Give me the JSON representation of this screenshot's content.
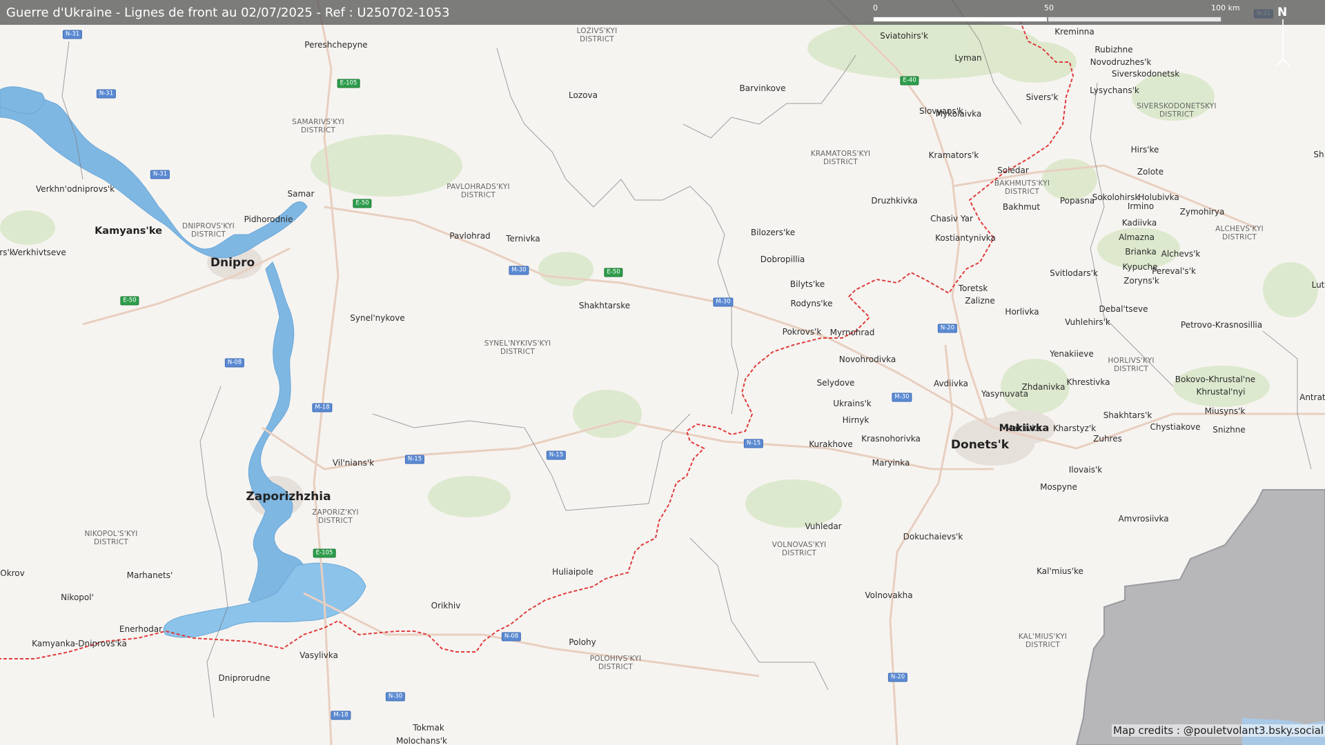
{
  "title": "Guerre d'Ukraine - Lignes de front au 02/07/2025 - Ref : U250702-1053",
  "scale": {
    "labels": [
      "0",
      "50",
      "100 km"
    ]
  },
  "north_label": "N",
  "credits": "Map credits : @pouletvolant3.bsky.social",
  "colors": {
    "frontline": "#e03a3a",
    "water": "#7fb7e3",
    "occupied": "#b7b7ba",
    "land": "#f6f4f1",
    "shield_e": "#2e9d4c",
    "shield_m": "#5b8ad2"
  },
  "cities": [
    "Pereshchepyne",
    "Lozova",
    "Barvinkove",
    "Sviatohirs'k",
    "Lyman",
    "Kreminna",
    "Rubizhne",
    "Novodruzhes'k",
    "Siverskodonetsk",
    "Lysychans'k",
    "Sivers'k",
    "Mykolaivka",
    "Slovyans'k",
    "Kramators'k",
    "Soledar",
    "Hirs'ke",
    "Zolote",
    "Druzhkivka",
    "Bakhmut",
    "Popasna",
    "Sokolohirsk",
    "Holubivka",
    "Irmino",
    "Zymohirya",
    "Chasiv Yar",
    "Kadiivka",
    "Kostiantynivka",
    "Almazna",
    "Bilozers'ke",
    "Brianka",
    "Alchevs'k",
    "Dobropillia",
    "Kypuche",
    "Pereval's'k",
    "Zoryns'k",
    "Bilyts'ke",
    "Toretsk",
    "Svitlodars'k",
    "Zalizne",
    "Rodyns'ke",
    "Horlivka",
    "Debal'tseve",
    "Vuhlehirs'k",
    "Petrovo-Krasnosillia",
    "Pokrovs'k",
    "Myrnohrad",
    "Novohrodivka",
    "Yenakiieve",
    "Selydove",
    "Avdiivka",
    "Zhdanivka",
    "Khrestivka",
    "Bokovo-Khrustal'ne",
    "Khrustal'nyi",
    "Yasynuvata",
    "Ukrains'k",
    "Hirnyk",
    "Makiivka",
    "Shakhtars'k",
    "Miusyns'k",
    "Kharstyz'k",
    "Chystiakove",
    "Snizhne",
    "Zuhres",
    "Krasnohorivka",
    "Kurakhove",
    "Maryinka",
    "Ilovais'k",
    "Mospyne",
    "Vuhledar",
    "Amvrosiivka",
    "Dokuchaievs'k",
    "Kal'mius'ke",
    "Volnovakha",
    "Verkhn'odniprovs'k",
    "Samar",
    "Pidhorodnie",
    "Pavlohrad",
    "Ternivka",
    "Verkhivtseve",
    "Shakhtarske",
    "Synel'nykove",
    "Vil'nians'k",
    "Huliaipole",
    "Marhanets'",
    "Enerhodar",
    "Kamyanka-Dniprovs'ka",
    "Orikhiv",
    "Vasylivka",
    "Dniprorudne",
    "Polohy",
    "Tokmak",
    "Molochans'k",
    "Okrov",
    "rs'k",
    "Nikopol'",
    "Sh",
    "Lut",
    "Antrats"
  ],
  "big_cities": [
    "Dnipro",
    "Zaporizhzhia",
    "Donets'k"
  ],
  "medium_cities": [
    "Kamyans'ke",
    "Makiivka"
  ],
  "districts": [
    "LOZIVS'KYI\nDISTRICT",
    "SAMARIVS'KYI\nDISTRICT",
    "PAVLOHRADS'KYI\nDISTRICT",
    "DNIPROVS'KYI\nDISTRICT",
    "KRAMATORS'KYI\nDISTRICT",
    "BAKHMUTS'KYI\nDISTRICT",
    "SIVERSKODONETSKYI\nDISTRICT",
    "ALCHEVS'KYI\nDISTRICT",
    "SYNEL'NYKIVS'KYI\nDISTRICT",
    "HORLIVS'KYI\nDISTRICT",
    "ZAPORIZ'KYI\nDISTRICT",
    "NIKOPOL'S'KYI\nDISTRICT",
    "VOLNOVAS'KYI\nDISTRICT",
    "POLOHIVS'KYI\nDISTRICT",
    "KAL'MIUS'KYI\nDISTRICT"
  ],
  "road_shields": [
    {
      "label": "N-31",
      "type": "m"
    },
    {
      "label": "E-105",
      "type": "e"
    },
    {
      "label": "N-31",
      "type": "m"
    },
    {
      "label": "E-40",
      "type": "e"
    },
    {
      "label": "N-31",
      "type": "m"
    },
    {
      "label": "E-50",
      "type": "e"
    },
    {
      "label": "M-30",
      "type": "m"
    },
    {
      "label": "E-50",
      "type": "e"
    },
    {
      "label": "M-30",
      "type": "m"
    },
    {
      "label": "E-50",
      "type": "e"
    },
    {
      "label": "N-21",
      "type": "m"
    },
    {
      "label": "N-20",
      "type": "m"
    },
    {
      "label": "N-08",
      "type": "m"
    },
    {
      "label": "M-18",
      "type": "m"
    },
    {
      "label": "M-30",
      "type": "m"
    },
    {
      "label": "N-15",
      "type": "m"
    },
    {
      "label": "N-15",
      "type": "m"
    },
    {
      "label": "N-15",
      "type": "m"
    },
    {
      "label": "E-105",
      "type": "e"
    },
    {
      "label": "N-08",
      "type": "m"
    },
    {
      "label": "N-30",
      "type": "m"
    },
    {
      "label": "M-18",
      "type": "m"
    },
    {
      "label": "N-20",
      "type": "m"
    }
  ]
}
